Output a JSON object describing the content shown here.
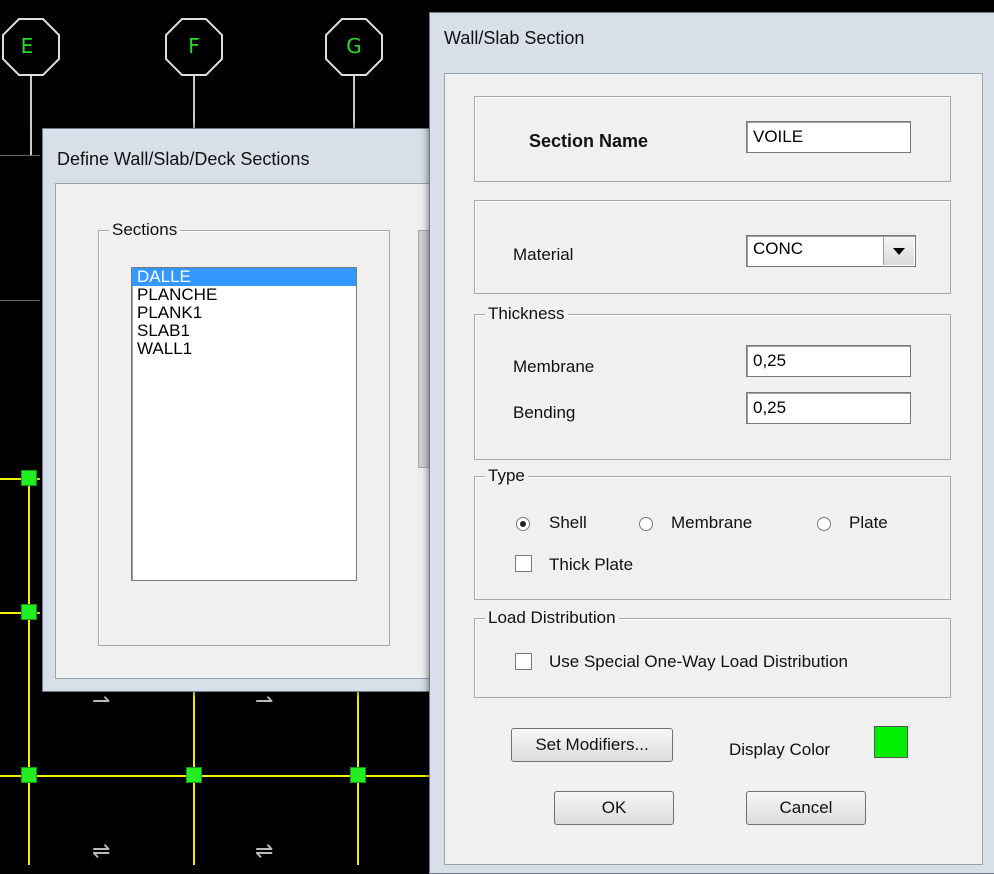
{
  "background": {
    "grid_bubbles": [
      "E",
      "F",
      "G"
    ]
  },
  "define_dialog": {
    "title": "Define Wall/Slab/Deck Sections",
    "sections_legend": "Sections",
    "sections": [
      "DALLE",
      "PLANCHE",
      "PLANK1",
      "SLAB1",
      "WALL1"
    ],
    "selected_index": 0
  },
  "wall_dialog": {
    "title": "Wall/Slab Section",
    "section_name_label": "Section Name",
    "section_name_value": "VOILE",
    "material_label": "Material",
    "material_value": "CONC",
    "thickness_legend": "Thickness",
    "membrane_label": "Membrane",
    "membrane_value": "0,25",
    "bending_label": "Bending",
    "bending_value": "0,25",
    "type_legend": "Type",
    "type_options": [
      "Shell",
      "Membrane",
      "Plate"
    ],
    "type_selected": "Shell",
    "thick_plate_label": "Thick Plate",
    "thick_plate_checked": false,
    "load_legend": "Load Distribution",
    "one_way_label": "Use Special One-Way Load Distribution",
    "one_way_checked": false,
    "set_modifiers_label": "Set Modifiers...",
    "display_color_label": "Display Color",
    "display_color": "#00ee00",
    "ok_label": "OK",
    "cancel_label": "Cancel"
  }
}
